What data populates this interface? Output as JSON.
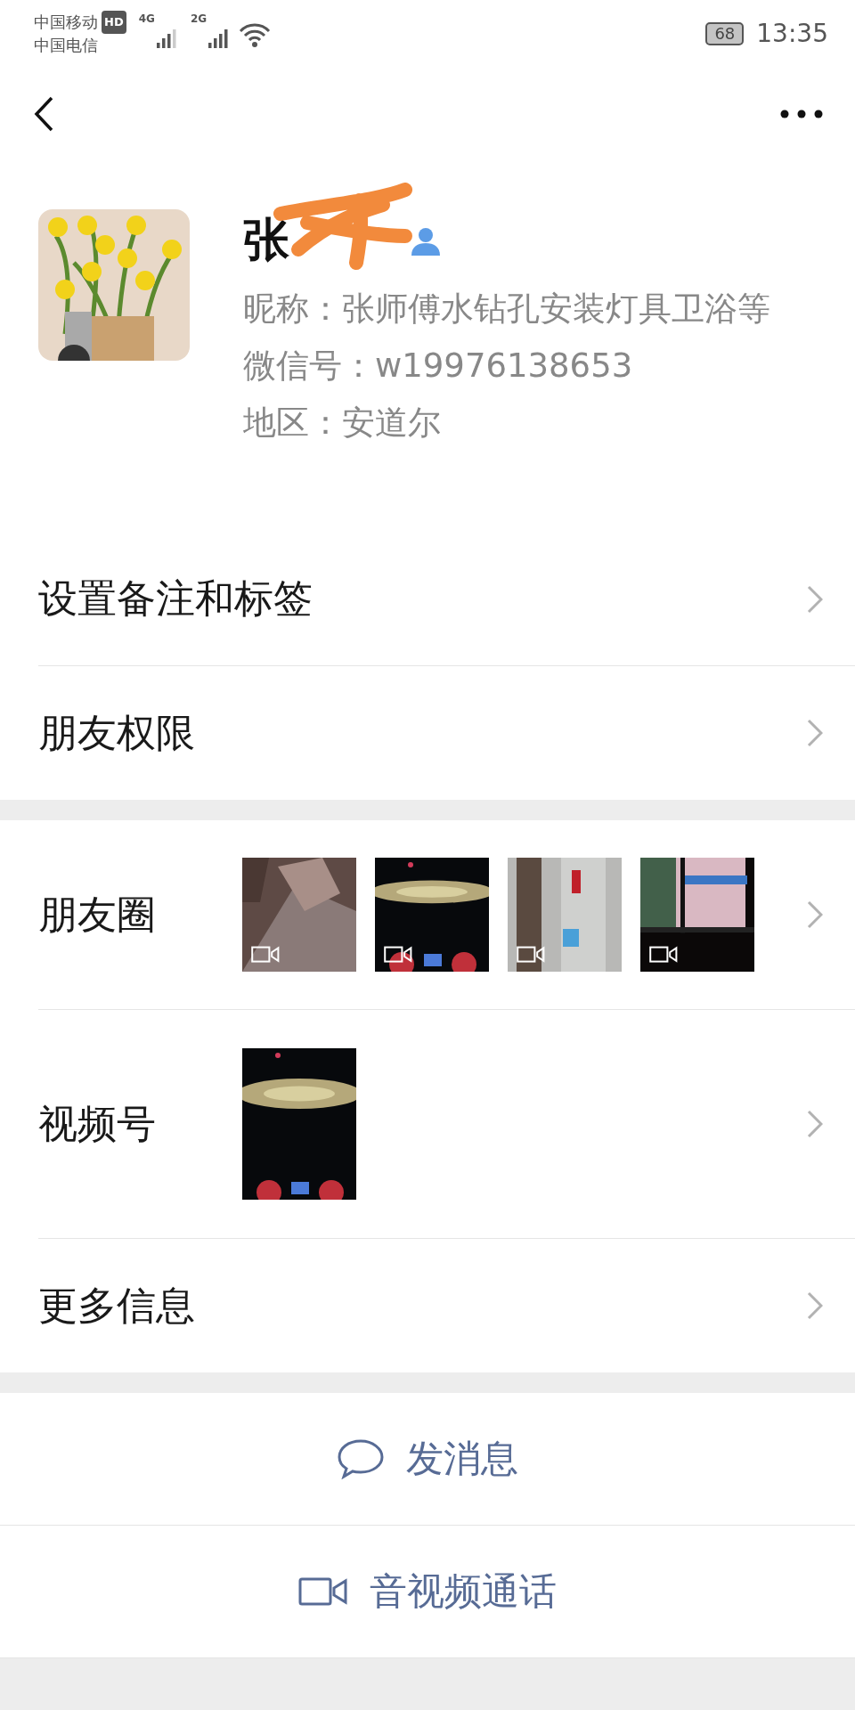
{
  "status_bar": {
    "carrier_1": "中国移动",
    "hd_badge": "HD",
    "carrier_2": "中国电信",
    "network_1": "4G",
    "network_2": "2G",
    "battery": "68",
    "time": "13:35"
  },
  "profile": {
    "name": "张",
    "name_redacted": true,
    "nickname": "昵称：张师傅水钻孔安装灯具卫浴等",
    "wechat_id": "微信号：w19976138653",
    "region": "地区：安道尔"
  },
  "sections": [
    {
      "rows": [
        {
          "kind": "plain",
          "label": "设置备注和标签"
        },
        {
          "kind": "plain",
          "label": "朋友权限"
        }
      ]
    },
    {
      "rows": [
        {
          "kind": "moments",
          "label": "朋友圈",
          "thumbs": [
            {
              "kind": "picture",
              "video": true
            },
            {
              "kind": "picture",
              "video": true
            },
            {
              "kind": "picture",
              "video": true
            },
            {
              "kind": "picture",
              "video": true
            }
          ]
        },
        {
          "kind": "channels",
          "label": "视频号",
          "thumbs": [
            {
              "kind": "picture",
              "video": false
            }
          ]
        },
        {
          "kind": "plain",
          "label": "更多信息"
        }
      ]
    }
  ],
  "actions": [
    {
      "kind": "message",
      "label": "发消息"
    },
    {
      "kind": "call",
      "label": "音视频通话"
    }
  ]
}
